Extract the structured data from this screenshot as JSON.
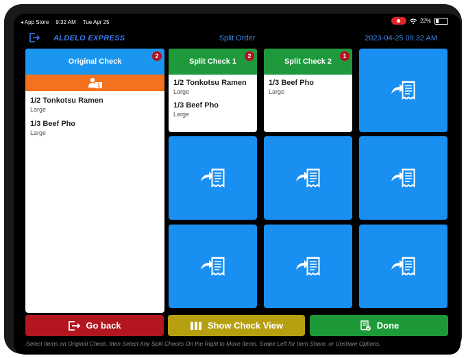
{
  "status_bar": {
    "back_app": "◂ App Store",
    "time": "9:32 AM",
    "date": "Tue Apr 25",
    "battery": "22%"
  },
  "header": {
    "brand": "ALDELO EXPRESS",
    "title": "Split Order",
    "datetime": "2023-04-25 09:32 AM"
  },
  "original_check": {
    "title": "Original Check",
    "badge": "2",
    "share_badge": "1",
    "items": [
      {
        "name": "1/2 Tonkotsu Ramen",
        "modifier": "Large"
      },
      {
        "name": "1/3 Beef Pho",
        "modifier": "Large"
      }
    ]
  },
  "split_checks": [
    {
      "title": "Split Check 1",
      "badge": "2",
      "items": [
        {
          "name": "1/2 Tonkotsu Ramen",
          "modifier": "Large"
        },
        {
          "name": "1/3 Beef Pho",
          "modifier": "Large"
        }
      ]
    },
    {
      "title": "Split Check 2",
      "badge": "1",
      "items": [
        {
          "name": "1/3 Beef Pho",
          "modifier": "Large"
        }
      ]
    }
  ],
  "buttons": {
    "go_back": "Go back",
    "show_check_view": "Show Check View",
    "done": "Done"
  },
  "hint": "Select Items on Original Check, then Select Any Split Checks On the Right to Move Items. Swipe Left for Item Share, or Unshare Options.",
  "colors": {
    "blue": "#1a8ff2",
    "green": "#1e9a3c",
    "orange": "#f4721e",
    "red": "#b3161f",
    "yellow": "#b6a00f",
    "done_green": "#1d9a37",
    "badge": "#b3121f"
  },
  "icons": {
    "tile": "move-to-check-icon",
    "share": "item-share-icon",
    "logout": "logout-icon"
  }
}
